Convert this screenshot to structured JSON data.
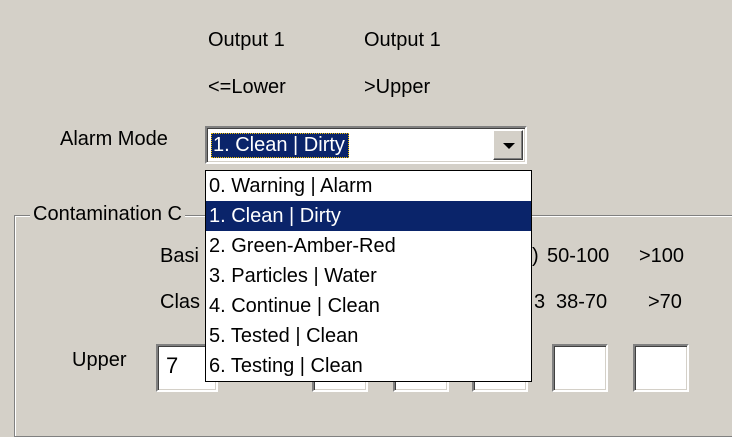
{
  "header": {
    "col1_title": "Output 1",
    "col2_title": "Output 1",
    "col1_sub": "<=Lower",
    "col2_sub": ">Upper"
  },
  "alarm_mode": {
    "label": "Alarm Mode",
    "selected": "1. Clean | Dirty",
    "options": [
      "0. Warning | Alarm",
      "1. Clean | Dirty",
      "2. Green-Amber-Red",
      "3. Particles | Water",
      "4. Continue | Clean",
      "5. Tested | Clean",
      "6. Testing | Clean"
    ],
    "highlighted_index": 1
  },
  "contamination": {
    "group_title": "Contamination C",
    "basis_label": "Basi",
    "class_label": "Clas",
    "basis_partial": "",
    "class_partial": "",
    "basis_values": [
      "50-100",
      ">100"
    ],
    "class_values": [
      "38-70",
      ">70"
    ],
    "upper_label": "Upper",
    "upper_first_value": "7"
  },
  "colors": {
    "face": "#d4d0c8",
    "highlight": "#0a246a"
  }
}
